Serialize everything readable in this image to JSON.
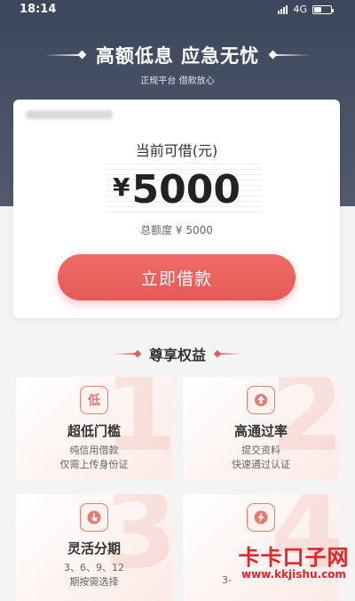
{
  "status_bar": {
    "time": "18:14",
    "network": "4G"
  },
  "hero": {
    "slogan": "高额低息 应急无忧",
    "subslogan": "正规平台 借款放心"
  },
  "loan_card": {
    "available_label": "当前可借(元)",
    "currency_symbol": "¥",
    "available_amount": "5000",
    "total_label": "总额度 ¥ 5000",
    "borrow_button": "立即借款"
  },
  "benefits": {
    "title": "尊享权益",
    "items": [
      {
        "icon": "low-threshold-icon",
        "icon_char": "低",
        "number": "1",
        "title": "超低门槛",
        "line1": "纯信用借款",
        "line2": "仅需上传身份证"
      },
      {
        "icon": "approval-arrow-icon",
        "number": "2",
        "title": "高通过率",
        "line1": "提交资料",
        "line2": "快速通过认证"
      },
      {
        "icon": "hand-pointer-icon",
        "number": "3",
        "title": "灵活分期",
        "line1": "3、6、9、12",
        "line2": "期按需选择"
      },
      {
        "icon": "lightning-icon",
        "number": "4",
        "title": "",
        "line1": "",
        "line2": "3-"
      }
    ]
  },
  "watermark": {
    "title": "卡卡口子网",
    "url": "www.kkjishu.com"
  },
  "colors": {
    "hero_bg": "#4a5366",
    "accent": "#e55a57",
    "watermark": "#e3242b"
  }
}
